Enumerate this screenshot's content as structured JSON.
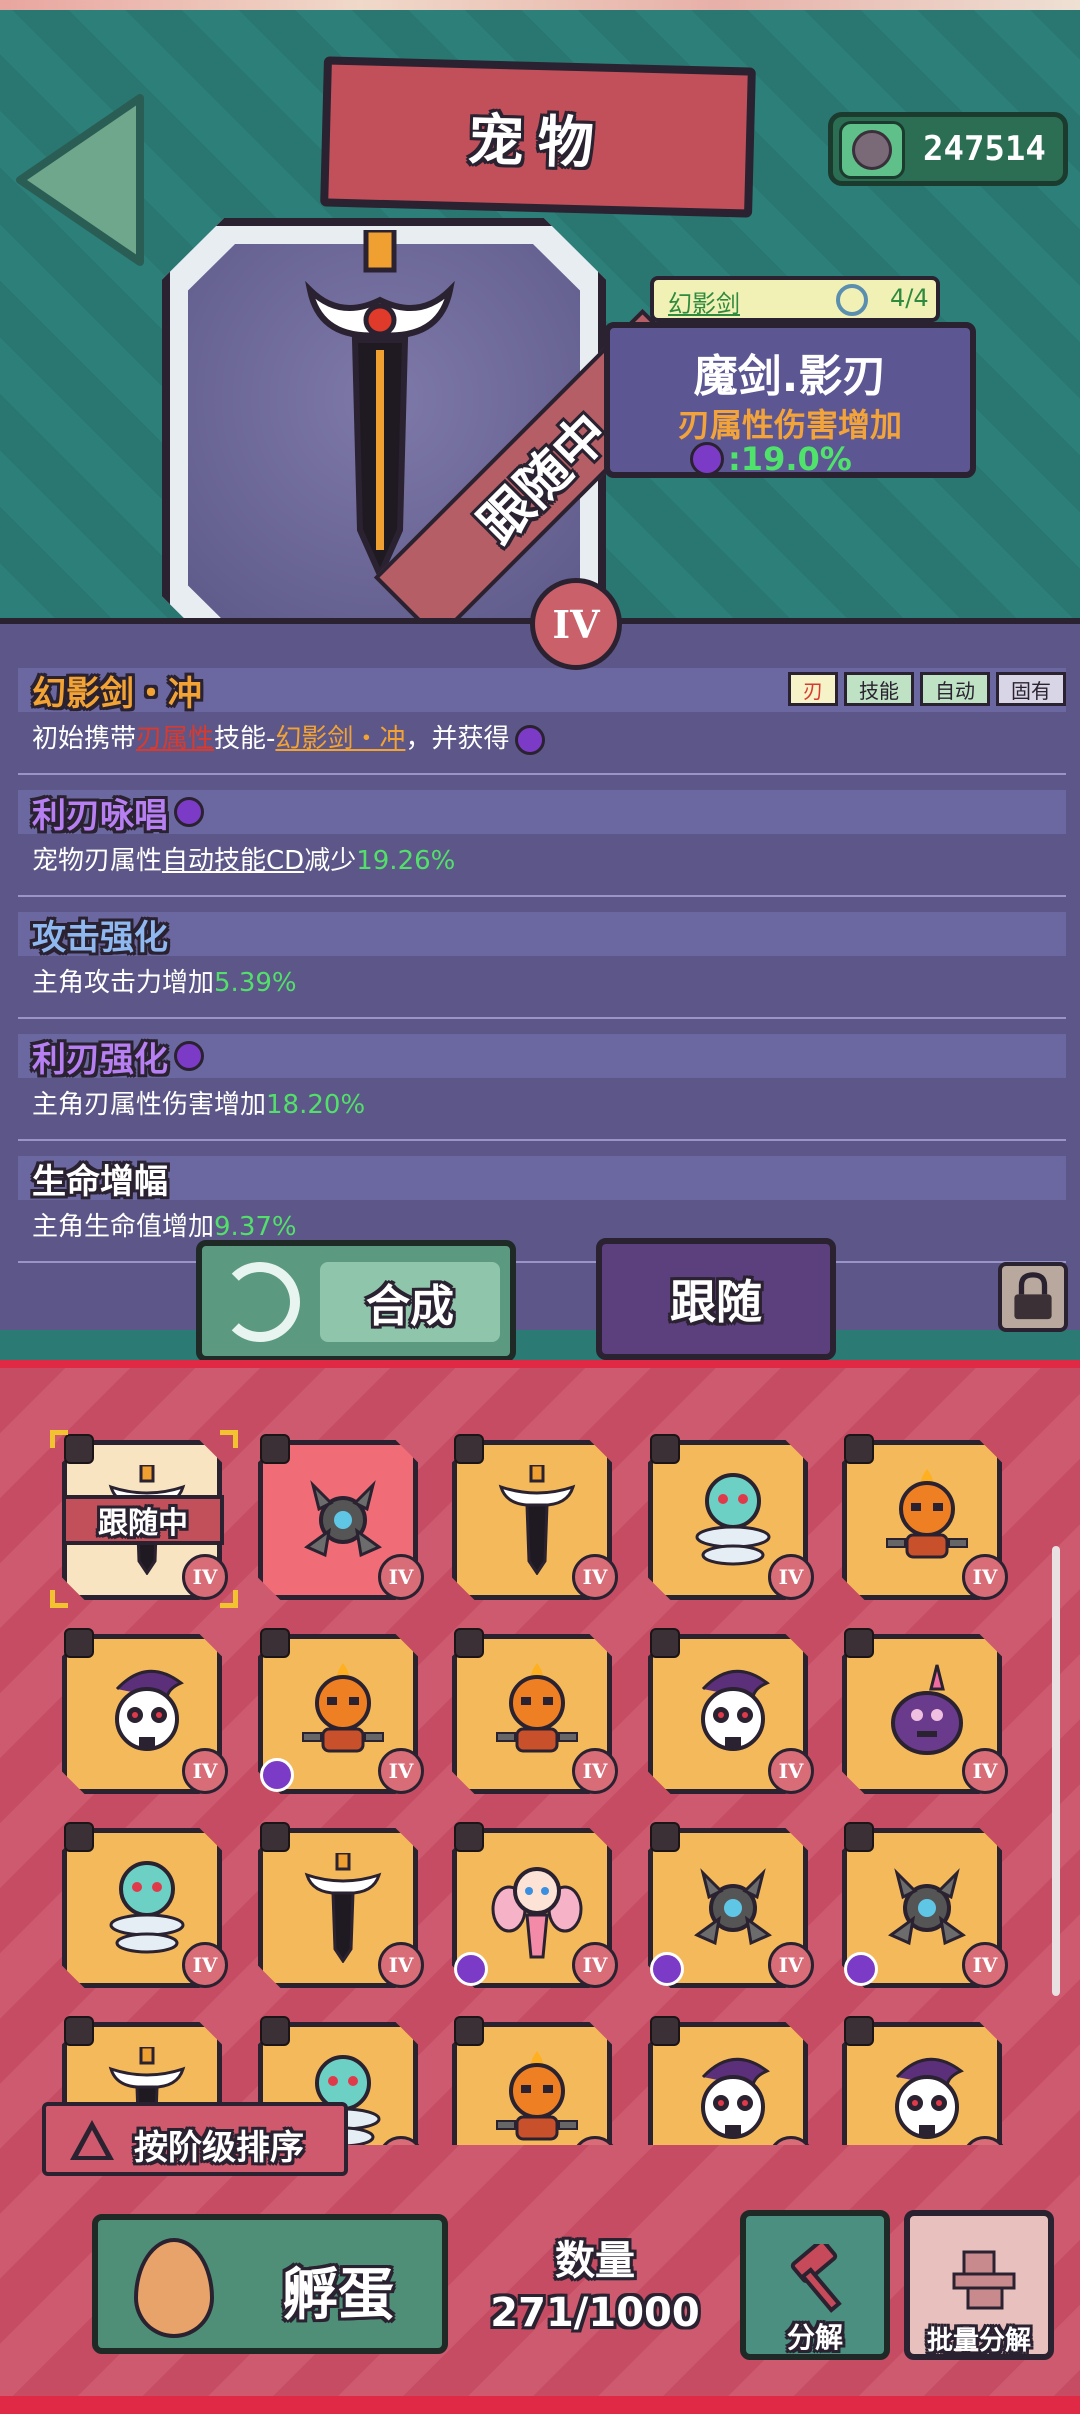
{
  "header": {
    "title": "宠物"
  },
  "currency": {
    "amount": "247514",
    "icon": "gem-coin-icon"
  },
  "pet": {
    "status_ribbon": "跟随中",
    "rank": "IV",
    "set_name": "幻影剑",
    "set_count": "4/4",
    "skill_name": "魔剑.影刃",
    "skill_effect": "刃属性伤害增加",
    "skill_value": ":19.0%"
  },
  "attributes": [
    {
      "title": "幻影剑・冲",
      "desc_pre": "初始携带",
      "desc_u1": "刃属性",
      "desc_mid": "技能-",
      "desc_u2": "幻影剑・冲",
      "desc_post": "，并获得",
      "tags": [
        "刃",
        "技能",
        "自动",
        "固有"
      ]
    },
    {
      "title": "利刃咏唱",
      "desc_pre": "宠物刃属性",
      "desc_u": "自动技能CD",
      "desc_mid": "减少",
      "value": "19.26%"
    },
    {
      "title": "攻击强化",
      "desc_pre": "主角攻击力增加",
      "value": "5.39%"
    },
    {
      "title": "利刃强化",
      "desc_pre": "主角刃属性伤害增加",
      "value": "18.20%"
    },
    {
      "title": "生命增幅",
      "desc_pre": "主角生命值增加",
      "value": "9.37%"
    }
  ],
  "actions": {
    "synthesize": "合成",
    "follow": "跟随"
  },
  "inventory": {
    "selected_tag": "跟随中",
    "rank_label": "IV",
    "sort_label": "按阶级排序",
    "hatch_label": "孵蛋",
    "count_label": "数量",
    "count_value": "271/1000",
    "decompose_label": "分解",
    "batch_decompose_label": "批量分解",
    "slots": [
      {
        "pet": "sword",
        "bg": "sel",
        "gem": false
      },
      {
        "pet": "turret",
        "bg": "red",
        "gem": false
      },
      {
        "pet": "sword",
        "bg": "orange",
        "gem": false
      },
      {
        "pet": "spring",
        "bg": "orange",
        "gem": false
      },
      {
        "pet": "pumpkin",
        "bg": "orange",
        "gem": false
      },
      {
        "pet": "skull",
        "bg": "orange",
        "gem": false
      },
      {
        "pet": "pumpkin",
        "bg": "orange",
        "gem": true
      },
      {
        "pet": "pumpkin",
        "bg": "orange",
        "gem": false
      },
      {
        "pet": "skull",
        "bg": "orange",
        "gem": false
      },
      {
        "pet": "slime",
        "bg": "orange",
        "gem": false
      },
      {
        "pet": "spring",
        "bg": "orange",
        "gem": false
      },
      {
        "pet": "sword",
        "bg": "orange",
        "gem": false
      },
      {
        "pet": "fairy",
        "bg": "orange",
        "gem": true
      },
      {
        "pet": "turret",
        "bg": "orange",
        "gem": true
      },
      {
        "pet": "turret",
        "bg": "orange",
        "gem": true
      },
      {
        "pet": "sword",
        "bg": "orange",
        "gem": false
      },
      {
        "pet": "spring",
        "bg": "orange",
        "gem": false
      },
      {
        "pet": "pumpkin",
        "bg": "orange",
        "gem": false
      },
      {
        "pet": "skull",
        "bg": "orange",
        "gem": false
      },
      {
        "pet": "skull",
        "bg": "orange",
        "gem": false
      }
    ]
  }
}
